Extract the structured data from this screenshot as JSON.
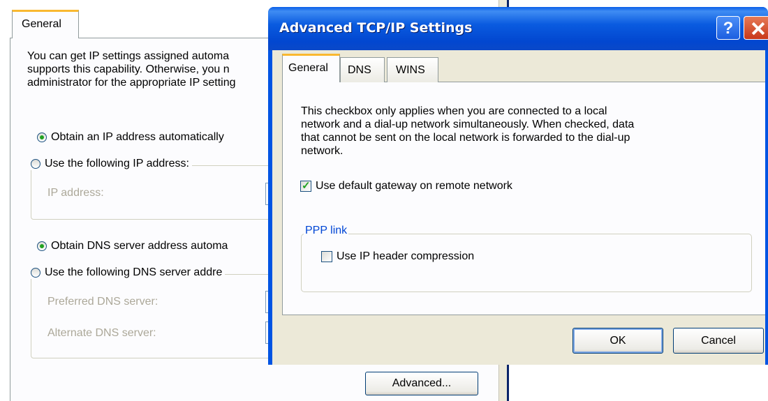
{
  "background_window": {
    "tab_general": "General",
    "description_lines": [
      "You can get IP settings assigned automa",
      "supports this capability. Otherwise, you n",
      "administrator for the appropriate IP setting"
    ],
    "radio_obtain_ip": "Obtain an IP address automatically",
    "radio_use_ip": "Use the following IP address:",
    "ip_address_label": "IP address:",
    "radio_obtain_dns": "Obtain DNS server address automa",
    "radio_use_dns": "Use the following DNS server addre",
    "preferred_dns_label": "Preferred DNS server:",
    "alternate_dns_label": "Alternate DNS server:",
    "advanced_button": "Advanced..."
  },
  "dialog": {
    "title": "Advanced TCP/IP Settings",
    "help_glyph": "?",
    "tabs": [
      {
        "label": "General",
        "active": true
      },
      {
        "label": "DNS",
        "active": false
      },
      {
        "label": "WINS",
        "active": false
      }
    ],
    "description_lines": [
      "This checkbox only applies when you are connected to a local",
      "network and a dial-up network simultaneously.  When checked, data",
      "that cannot be sent on the local network is forwarded to the dial-up",
      "network."
    ],
    "checkbox_default_gateway": {
      "label": "Use default gateway on remote network",
      "checked": true
    },
    "ppp_group_label": "PPP link",
    "checkbox_ip_header": {
      "label": "Use IP header compression",
      "checked": false
    },
    "ok_button": "OK",
    "cancel_button": "Cancel"
  },
  "colors": {
    "titlebar": "#0054e3",
    "dialog_face": "#ece9d8",
    "tab_highlight": "#f9b830",
    "group_label": "#0046d5",
    "check_mark": "#21a121"
  }
}
